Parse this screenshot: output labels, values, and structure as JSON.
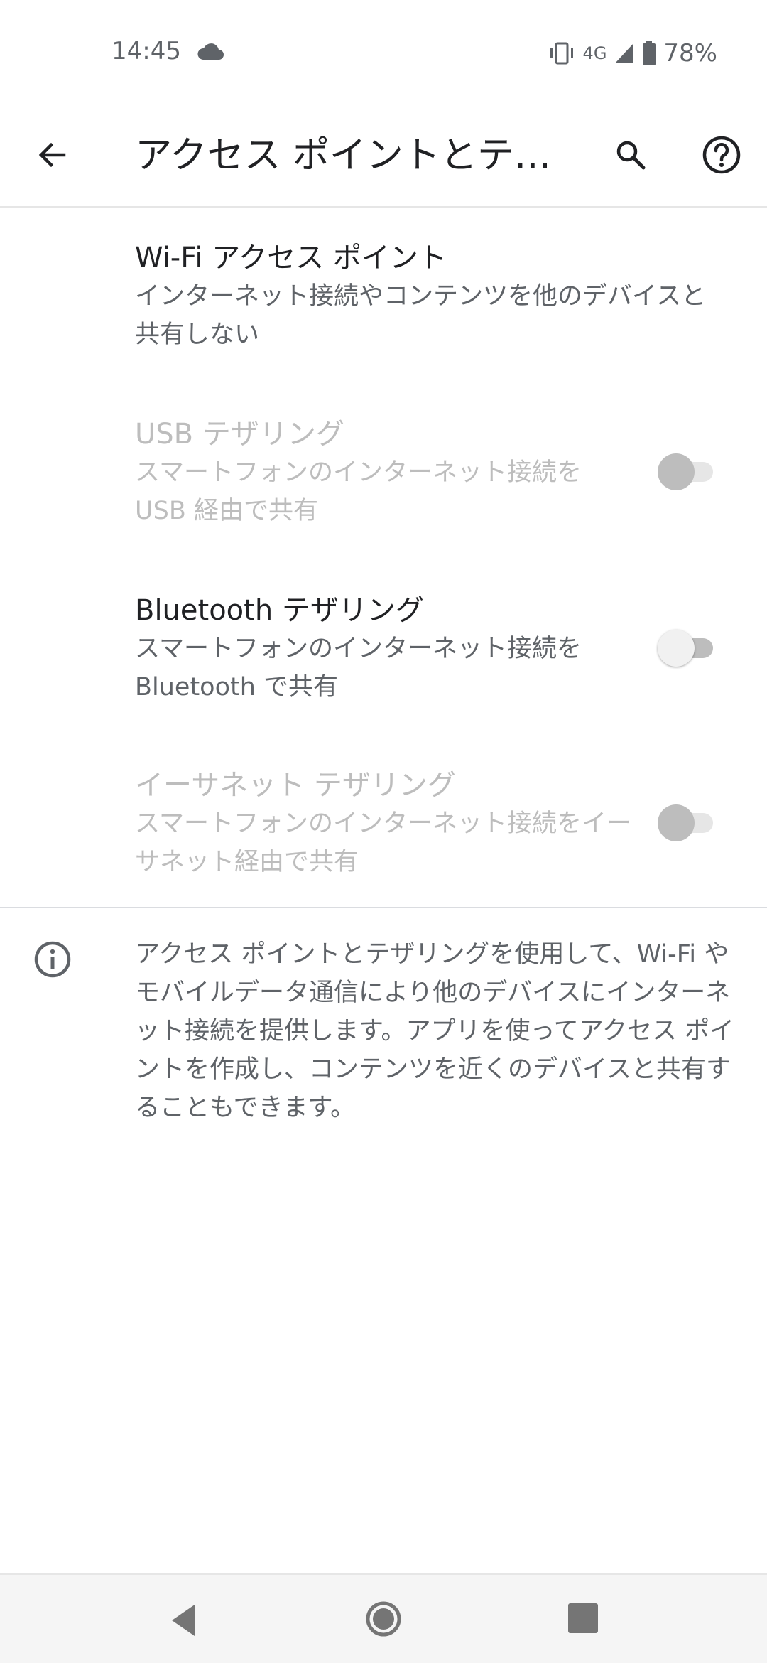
{
  "status_bar": {
    "time": "14:45",
    "network": "4G",
    "battery": "78%"
  },
  "app_bar": {
    "title": "アクセス ポイントとテザリング"
  },
  "prefs": {
    "wifi_hotspot": {
      "title": "Wi-Fi アクセス ポイント",
      "summary": "インターネット接続やコンテンツを他のデバイスと共有しない"
    },
    "usb_tethering": {
      "title": "USB テザリング",
      "summary": "スマートフォンのインターネット接続をUSB 経由で共有",
      "enabled": false,
      "checked": false
    },
    "bluetooth_tethering": {
      "title": "Bluetooth テザリング",
      "summary": "スマートフォンのインターネット接続をBluetooth で共有",
      "enabled": true,
      "checked": false
    },
    "ethernet_tethering": {
      "title": "イーサネット テザリング",
      "summary": "スマートフォンのインターネット接続をイーサネット経由で共有",
      "enabled": false,
      "checked": false
    }
  },
  "footer": {
    "text": "アクセス ポイントとテザリングを使用して、Wi-Fi やモバイルデータ通信により他のデバイスにインターネット接続を提供します。アプリを使ってアクセス ポイントを作成し、コンテンツを近くのデバイスと共有することもできます。"
  },
  "icons": {
    "back": "arrow-left",
    "search": "magnifier",
    "help": "question-circle",
    "info": "info-circle",
    "cloud": "cloud",
    "vibrate": "vibrate",
    "signal": "signal",
    "battery": "battery"
  }
}
